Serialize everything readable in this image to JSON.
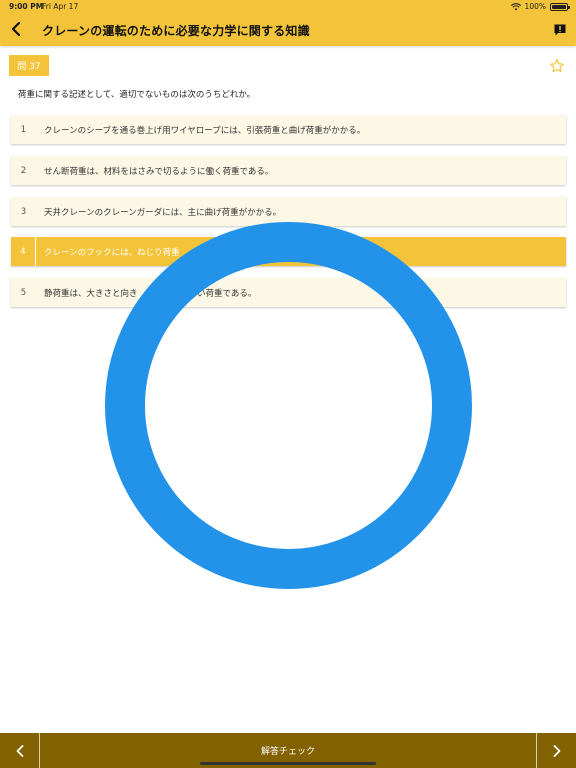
{
  "status_bar": {
    "time": "9:00 PM",
    "date": "Fri Apr 17",
    "battery": "100%"
  },
  "nav": {
    "title": "クレーンの運転のために必要な力学に関する知識",
    "back_icon": "chevron-left-icon",
    "report_icon": "report-icon"
  },
  "question": {
    "badge": "問 37",
    "text": "荷重に関する記述として、適切でないものは次のうちどれか。",
    "favorite_icon": "star-outline-icon"
  },
  "options": [
    {
      "num": "1",
      "text": "クレーンのシーブを通る巻上げ用ワイヤロープには、引張荷重と曲げ荷重がかかる。",
      "selected": false
    },
    {
      "num": "2",
      "text": "せん断荷重は、材料をはさみで切るように働く荷重である。",
      "selected": false
    },
    {
      "num": "3",
      "text": "天井クレーンのクレーンガーダには、主に曲げ荷重がかかる。",
      "selected": false
    },
    {
      "num": "4",
      "text": "クレーンのフックには、ねじり荷重",
      "selected": true
    },
    {
      "num": "5",
      "text": "静荷重は、大きさと向き　　　　　　　い荷重である。",
      "selected": false
    }
  ],
  "overlay": {
    "type": "correct-answer-ring",
    "color": "#2393ea"
  },
  "bottom_bar": {
    "check_label": "解答チェック",
    "prev_icon": "chevron-left-icon",
    "next_icon": "chevron-right-icon"
  },
  "colors": {
    "accent": "#f3c43a",
    "bottom": "#826200",
    "option_bg": "#fdf8e6"
  }
}
